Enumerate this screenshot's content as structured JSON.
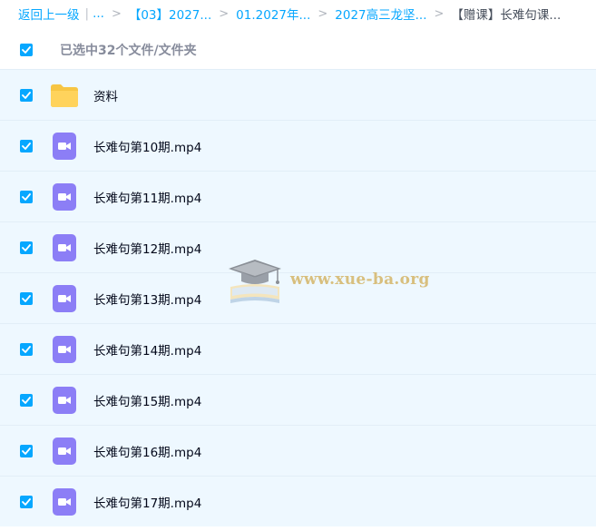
{
  "breadcrumb": {
    "back_label": "返回上一级",
    "pipe": "|",
    "ellipsis": "...",
    "separator": ">",
    "items": [
      "【03】2027...",
      "01.2027年...",
      "2027高三龙坚..."
    ],
    "current": "【赠课】长难句课..."
  },
  "selection": {
    "summary": "已选中32个文件/文件夹",
    "all_checked": true
  },
  "files": [
    {
      "name": "资料",
      "type": "folder",
      "checked": true,
      "icon": "folder-icon"
    },
    {
      "name": "长难句第10期.mp4",
      "type": "video",
      "checked": true,
      "icon": "video-file-icon"
    },
    {
      "name": "长难句第11期.mp4",
      "type": "video",
      "checked": true,
      "icon": "video-file-icon"
    },
    {
      "name": "长难句第12期.mp4",
      "type": "video",
      "checked": true,
      "icon": "video-file-icon"
    },
    {
      "name": "长难句第13期.mp4",
      "type": "video",
      "checked": true,
      "icon": "video-file-icon"
    },
    {
      "name": "长难句第14期.mp4",
      "type": "video",
      "checked": true,
      "icon": "video-file-icon"
    },
    {
      "name": "长难句第15期.mp4",
      "type": "video",
      "checked": true,
      "icon": "video-file-icon"
    },
    {
      "name": "长难句第16期.mp4",
      "type": "video",
      "checked": true,
      "icon": "video-file-icon"
    },
    {
      "name": "长难句第17期.mp4",
      "type": "video",
      "checked": true,
      "icon": "video-file-icon"
    }
  ],
  "watermark": {
    "text": "www.xue-ba.org",
    "icon": "graduation-cap-icon"
  },
  "colors": {
    "accent": "#06a7ff",
    "row_selected_bg": "#eef8ff",
    "folder": "#ffd35c",
    "video_icon": "#8c7ef6",
    "watermark": "#d8bf7e"
  }
}
